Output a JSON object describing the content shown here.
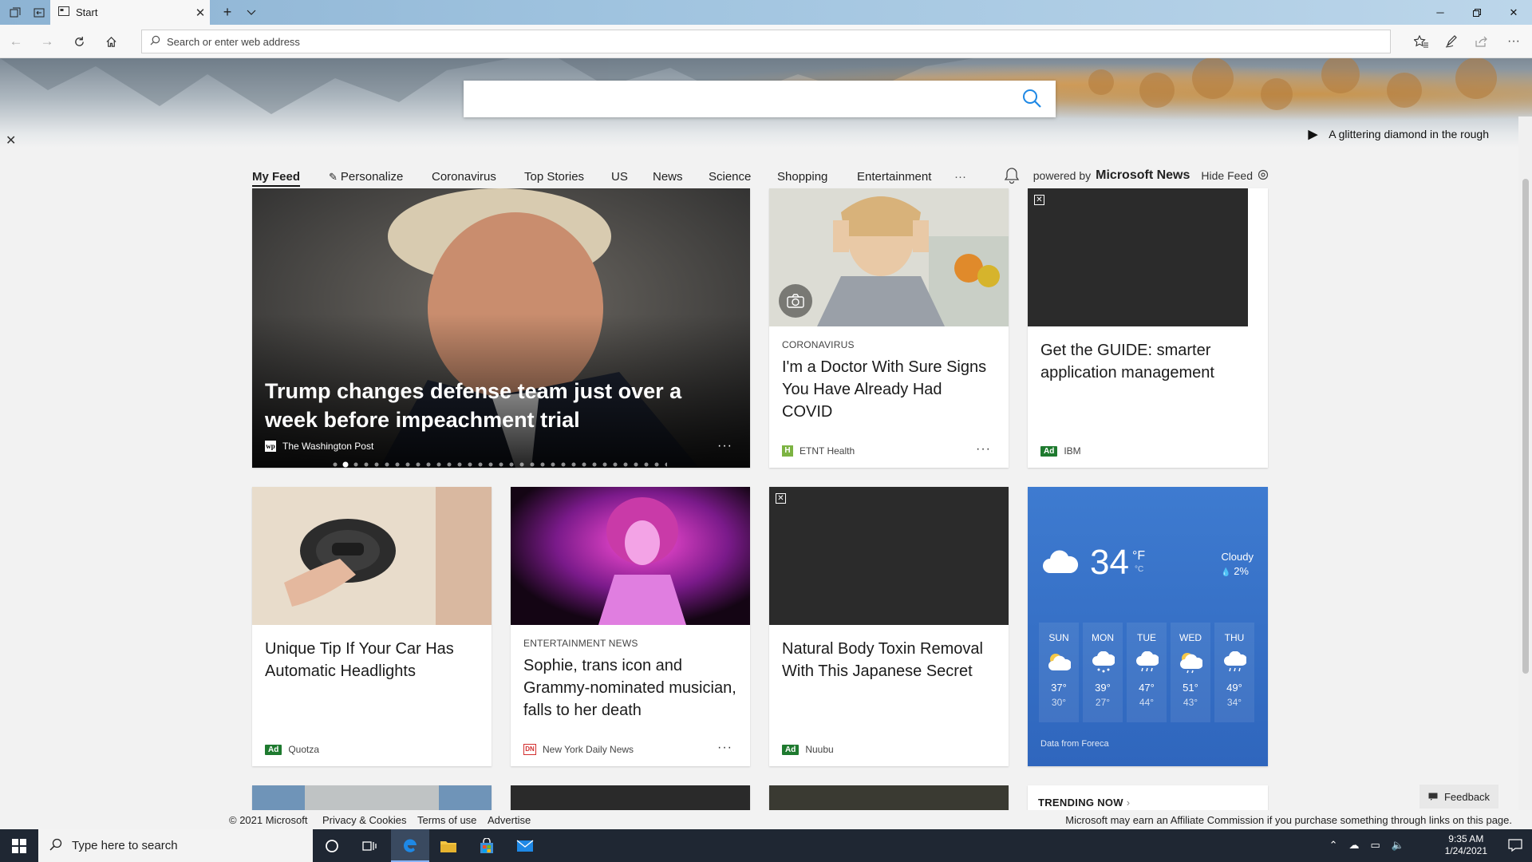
{
  "browser": {
    "tab_title": "Start",
    "address_placeholder": "Search or enter web address"
  },
  "hero": {
    "caption": "A glittering diamond in the rough"
  },
  "feed_nav": {
    "items": [
      "My Feed",
      "Personalize",
      "Coronavirus",
      "Top Stories",
      "US",
      "News",
      "Science",
      "Shopping",
      "Entertainment"
    ],
    "more": "···",
    "powered_by": "powered by",
    "powered_brand": "Microsoft News",
    "hide_feed": "Hide Feed"
  },
  "cards": {
    "hero_story": {
      "title": "Trump changes defense team just over a week before impeachment trial",
      "source": "The Washington Post",
      "more": "···"
    },
    "covid": {
      "category": "CORONAVIRUS",
      "title": "I'm a Doctor With Sure Signs You Have Already Had COVID",
      "source": "ETNT Health",
      "more": "···"
    },
    "ibm_ad": {
      "title": "Get the GUIDE: smarter application management",
      "ad_label": "Ad",
      "source": "IBM"
    },
    "headlights_ad": {
      "title": "Unique Tip If Your Car Has Automatic Headlights",
      "ad_label": "Ad",
      "source": "Quotza"
    },
    "sophie": {
      "category": "ENTERTAINMENT NEWS",
      "title": "Sophie, trans icon and Grammy-nominated musician, falls to her death",
      "source": "New York Daily News",
      "more": "···"
    },
    "toxin_ad": {
      "title": "Natural Body Toxin Removal With This Japanese Secret",
      "ad_label": "Ad",
      "source": "Nuubu"
    }
  },
  "weather": {
    "temp": "34",
    "unit_f": "°F",
    "unit_c": "°C",
    "condition": "Cloudy",
    "precip": "2%",
    "source": "Data from Foreca",
    "days": [
      {
        "name": "SUN",
        "hi": "37°",
        "lo": "30°",
        "icon": "partly-sunny-icon"
      },
      {
        "name": "MON",
        "hi": "39°",
        "lo": "27°",
        "icon": "snow-cloud-icon"
      },
      {
        "name": "TUE",
        "hi": "47°",
        "lo": "44°",
        "icon": "rain-cloud-icon"
      },
      {
        "name": "WED",
        "hi": "51°",
        "lo": "43°",
        "icon": "partly-sunny-rain-icon"
      },
      {
        "name": "THU",
        "hi": "49°",
        "lo": "34°",
        "icon": "rain-cloud-icon"
      }
    ]
  },
  "trending": {
    "title": "TRENDING NOW"
  },
  "feedback": {
    "label": "Feedback"
  },
  "footer": {
    "copyright": "© 2021 Microsoft",
    "privacy": "Privacy & Cookies",
    "terms": "Terms of use",
    "advertise": "Advertise",
    "affiliate": "Microsoft may earn an Affiliate Commission if you purchase something through links on this page."
  },
  "taskbar": {
    "search_placeholder": "Type here to search",
    "time": "9:35 AM",
    "date": "1/24/2021"
  },
  "colors": {
    "ad_badge": "#1e7a2f",
    "weather_bg": "#3e7bd0",
    "taskbar_bg": "#1f2733",
    "edge_blue": "#1e88e5"
  }
}
